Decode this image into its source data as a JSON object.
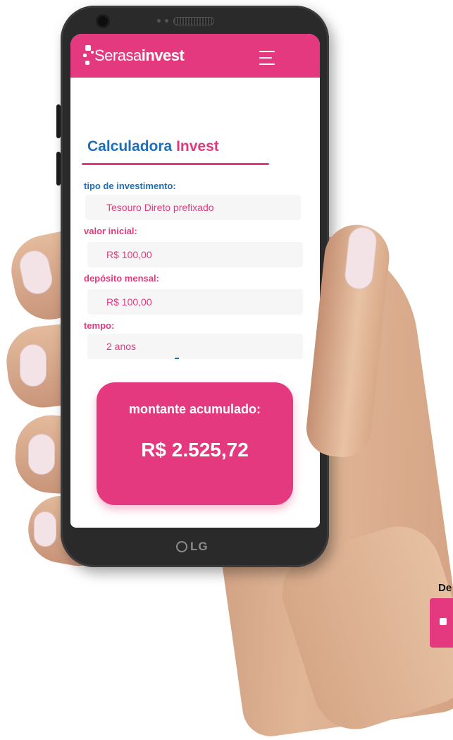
{
  "app": {
    "logo_light": "Serasa",
    "logo_bold": "invest"
  },
  "calculator": {
    "title_part1": "Calculadora",
    "title_part2": "Invest",
    "fields": {
      "tipo": {
        "label": "tipo de investimento:",
        "value": "Tesouro Direto prefixado"
      },
      "valor": {
        "label": "valor inicial:",
        "value": "R$ 100,00"
      },
      "deposito": {
        "label": "depósito mensal:",
        "value": "R$ 100,00"
      },
      "tempo": {
        "label": "tempo:",
        "value": "2 anos"
      }
    },
    "result": {
      "label": "montante acumulado:",
      "value": "R$ 2.525,72"
    }
  },
  "device": {
    "brand": "LG"
  },
  "corner": {
    "text": "De"
  },
  "colors": {
    "brand_pink": "#e5397f",
    "brand_blue": "#1e6fb8"
  },
  "icons": {
    "menu": "hamburger-menu-icon",
    "logo": "serasa-logo-mark"
  }
}
